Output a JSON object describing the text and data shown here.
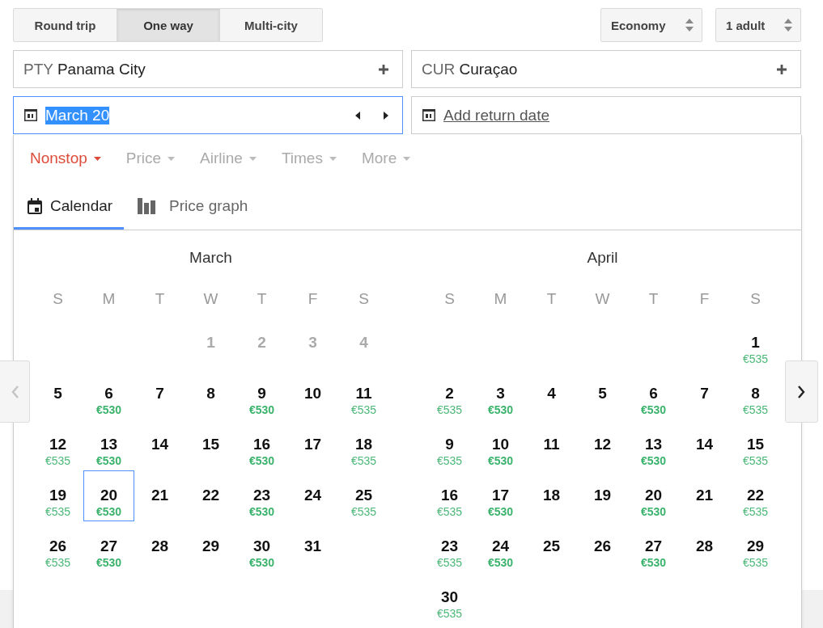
{
  "trip_types": [
    {
      "label": "Round trip",
      "selected": false
    },
    {
      "label": "One way",
      "selected": true
    },
    {
      "label": "Multi-city",
      "selected": false
    }
  ],
  "cabin": {
    "value": "Economy"
  },
  "passengers": {
    "value": "1 adult"
  },
  "origin": {
    "code": "PTY",
    "name": "Panama City"
  },
  "destination": {
    "code": "CUR",
    "name": "Curaçao"
  },
  "depart_date": {
    "value": "March 20",
    "focused": true
  },
  "return_date": {
    "link": "Add return date"
  },
  "filters": [
    {
      "label": "Nonstop",
      "active": true
    },
    {
      "label": "Price",
      "active": false
    },
    {
      "label": "Airline",
      "active": false
    },
    {
      "label": "Times",
      "active": false
    },
    {
      "label": "More",
      "active": false
    }
  ],
  "view_tabs": [
    {
      "label": "Calendar",
      "selected": true
    },
    {
      "label": "Price graph",
      "selected": false
    }
  ],
  "prev_month": {
    "disabled": true
  },
  "next_month": {
    "disabled": false
  },
  "months": [
    {
      "name": "March",
      "weekdays": [
        "S",
        "M",
        "T",
        "W",
        "T",
        "F",
        "S"
      ],
      "weeks": [
        [
          {
            "kind": "blank"
          },
          {
            "kind": "blank"
          },
          {
            "kind": "blank"
          },
          {
            "kind": "day",
            "day": "1",
            "disabled": true,
            "selected": false
          },
          {
            "kind": "day",
            "day": "2",
            "disabled": true,
            "selected": false
          },
          {
            "kind": "day",
            "day": "3",
            "disabled": true,
            "selected": false
          },
          {
            "kind": "day",
            "day": "4",
            "disabled": true,
            "selected": false
          }
        ],
        [
          {
            "kind": "day",
            "day": "5",
            "disabled": false,
            "selected": false
          },
          {
            "kind": "day",
            "day": "6",
            "price": "€530",
            "cheapest": true,
            "disabled": false,
            "selected": false
          },
          {
            "kind": "day",
            "day": "7",
            "disabled": false,
            "selected": false
          },
          {
            "kind": "day",
            "day": "8",
            "disabled": false,
            "selected": false
          },
          {
            "kind": "day",
            "day": "9",
            "price": "€530",
            "cheapest": true,
            "disabled": false,
            "selected": false
          },
          {
            "kind": "day",
            "day": "10",
            "disabled": false,
            "selected": false
          },
          {
            "kind": "day",
            "day": "11",
            "price": "€535",
            "cheapest": false,
            "disabled": false,
            "selected": false
          }
        ],
        [
          {
            "kind": "day",
            "day": "12",
            "price": "€535",
            "cheapest": false,
            "disabled": false,
            "selected": false
          },
          {
            "kind": "day",
            "day": "13",
            "price": "€530",
            "cheapest": true,
            "disabled": false,
            "selected": false
          },
          {
            "kind": "day",
            "day": "14",
            "disabled": false,
            "selected": false
          },
          {
            "kind": "day",
            "day": "15",
            "disabled": false,
            "selected": false
          },
          {
            "kind": "day",
            "day": "16",
            "price": "€530",
            "cheapest": true,
            "disabled": false,
            "selected": false
          },
          {
            "kind": "day",
            "day": "17",
            "disabled": false,
            "selected": false
          },
          {
            "kind": "day",
            "day": "18",
            "price": "€535",
            "cheapest": false,
            "disabled": false,
            "selected": false
          }
        ],
        [
          {
            "kind": "day",
            "day": "19",
            "price": "€535",
            "cheapest": false,
            "disabled": false,
            "selected": false
          },
          {
            "kind": "day",
            "day": "20",
            "price": "€530",
            "cheapest": true,
            "disabled": false,
            "selected": true
          },
          {
            "kind": "day",
            "day": "21",
            "disabled": false,
            "selected": false
          },
          {
            "kind": "day",
            "day": "22",
            "disabled": false,
            "selected": false
          },
          {
            "kind": "day",
            "day": "23",
            "price": "€530",
            "cheapest": true,
            "disabled": false,
            "selected": false
          },
          {
            "kind": "day",
            "day": "24",
            "disabled": false,
            "selected": false
          },
          {
            "kind": "day",
            "day": "25",
            "price": "€535",
            "cheapest": false,
            "disabled": false,
            "selected": false
          }
        ],
        [
          {
            "kind": "day",
            "day": "26",
            "price": "€535",
            "cheapest": false,
            "disabled": false,
            "selected": false
          },
          {
            "kind": "day",
            "day": "27",
            "price": "€530",
            "cheapest": true,
            "disabled": false,
            "selected": false
          },
          {
            "kind": "day",
            "day": "28",
            "disabled": false,
            "selected": false
          },
          {
            "kind": "day",
            "day": "29",
            "disabled": false,
            "selected": false
          },
          {
            "kind": "day",
            "day": "30",
            "price": "€530",
            "cheapest": true,
            "disabled": false,
            "selected": false
          },
          {
            "kind": "day",
            "day": "31",
            "disabled": false,
            "selected": false
          }
        ]
      ]
    },
    {
      "name": "April",
      "weekdays": [
        "S",
        "M",
        "T",
        "W",
        "T",
        "F",
        "S"
      ],
      "weeks": [
        [
          {
            "kind": "blank"
          },
          {
            "kind": "blank"
          },
          {
            "kind": "blank"
          },
          {
            "kind": "blank"
          },
          {
            "kind": "blank"
          },
          {
            "kind": "blank"
          },
          {
            "kind": "day",
            "day": "1",
            "price": "€535",
            "cheapest": false,
            "disabled": false,
            "selected": false
          }
        ],
        [
          {
            "kind": "day",
            "day": "2",
            "price": "€535",
            "cheapest": false,
            "disabled": false,
            "selected": false
          },
          {
            "kind": "day",
            "day": "3",
            "price": "€530",
            "cheapest": true,
            "disabled": false,
            "selected": false
          },
          {
            "kind": "day",
            "day": "4",
            "disabled": false,
            "selected": false
          },
          {
            "kind": "day",
            "day": "5",
            "disabled": false,
            "selected": false
          },
          {
            "kind": "day",
            "day": "6",
            "price": "€530",
            "cheapest": true,
            "disabled": false,
            "selected": false
          },
          {
            "kind": "day",
            "day": "7",
            "disabled": false,
            "selected": false
          },
          {
            "kind": "day",
            "day": "8",
            "price": "€535",
            "cheapest": false,
            "disabled": false,
            "selected": false
          }
        ],
        [
          {
            "kind": "day",
            "day": "9",
            "price": "€535",
            "cheapest": false,
            "disabled": false,
            "selected": false
          },
          {
            "kind": "day",
            "day": "10",
            "price": "€530",
            "cheapest": true,
            "disabled": false,
            "selected": false
          },
          {
            "kind": "day",
            "day": "11",
            "disabled": false,
            "selected": false
          },
          {
            "kind": "day",
            "day": "12",
            "disabled": false,
            "selected": false
          },
          {
            "kind": "day",
            "day": "13",
            "price": "€530",
            "cheapest": true,
            "disabled": false,
            "selected": false
          },
          {
            "kind": "day",
            "day": "14",
            "disabled": false,
            "selected": false
          },
          {
            "kind": "day",
            "day": "15",
            "price": "€535",
            "cheapest": false,
            "disabled": false,
            "selected": false
          }
        ],
        [
          {
            "kind": "day",
            "day": "16",
            "price": "€535",
            "cheapest": false,
            "disabled": false,
            "selected": false
          },
          {
            "kind": "day",
            "day": "17",
            "price": "€530",
            "cheapest": true,
            "disabled": false,
            "selected": false
          },
          {
            "kind": "day",
            "day": "18",
            "disabled": false,
            "selected": false
          },
          {
            "kind": "day",
            "day": "19",
            "disabled": false,
            "selected": false
          },
          {
            "kind": "day",
            "day": "20",
            "price": "€530",
            "cheapest": true,
            "disabled": false,
            "selected": false
          },
          {
            "kind": "day",
            "day": "21",
            "disabled": false,
            "selected": false
          },
          {
            "kind": "day",
            "day": "22",
            "price": "€535",
            "cheapest": false,
            "disabled": false,
            "selected": false
          }
        ],
        [
          {
            "kind": "day",
            "day": "23",
            "price": "€535",
            "cheapest": false,
            "disabled": false,
            "selected": false
          },
          {
            "kind": "day",
            "day": "24",
            "price": "€530",
            "cheapest": true,
            "disabled": false,
            "selected": false
          },
          {
            "kind": "day",
            "day": "25",
            "disabled": false,
            "selected": false
          },
          {
            "kind": "day",
            "day": "26",
            "disabled": false,
            "selected": false
          },
          {
            "kind": "day",
            "day": "27",
            "price": "€530",
            "cheapest": true,
            "disabled": false,
            "selected": false
          },
          {
            "kind": "day",
            "day": "28",
            "disabled": false,
            "selected": false
          },
          {
            "kind": "day",
            "day": "29",
            "price": "€535",
            "cheapest": false,
            "disabled": false,
            "selected": false
          }
        ],
        [
          {
            "kind": "day",
            "day": "30",
            "price": "€535",
            "cheapest": false,
            "disabled": false,
            "selected": false
          }
        ]
      ]
    }
  ]
}
